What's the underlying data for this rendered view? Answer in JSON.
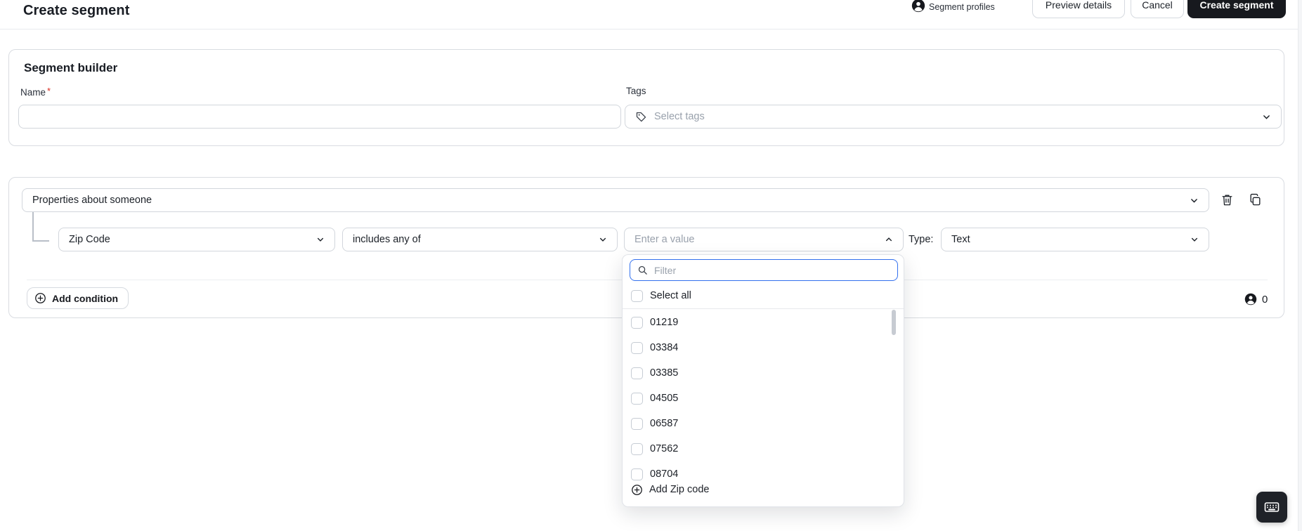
{
  "topbar": {
    "title": "Create segment",
    "profiles_label": "Segment profiles",
    "buttons": {
      "preview": "Preview details",
      "cancel": "Cancel",
      "create": "Create segment"
    }
  },
  "builder_card": {
    "title": "Segment builder",
    "name_label": "Name",
    "required_mark": "*",
    "name_value": "",
    "tags_label": "Tags",
    "tags_placeholder": "Select tags"
  },
  "filter_card": {
    "group_select_value": "Properties about someone",
    "field_select_value": "Zip Code",
    "operator_select_value": "includes any of",
    "value_placeholder": "Enter a value",
    "type_label": "Type:",
    "type_select_value": "Text",
    "add_condition_label": "Add condition",
    "contact_count": "0"
  },
  "value_dropdown": {
    "filter_placeholder": "Filter",
    "select_all_label": "Select all",
    "options": [
      "01219",
      "03384",
      "03385",
      "04505",
      "06587",
      "07562",
      "08704"
    ],
    "add_option_label": "Add Zip code"
  },
  "icons": {
    "profiles": "person-circle-icon",
    "tags": "tag-icon",
    "selects": "chevron-down-icon",
    "value_open": "chevron-up-icon",
    "row_actions": [
      "trash-icon",
      "copy-icon"
    ],
    "filter_input": "search-icon",
    "add_buttons": "plus-circle-icon",
    "floating": "keyboard-icon"
  },
  "colors": {
    "accent_blue": "#3270ee",
    "dark_button": "#17191e",
    "required_red": "#d92d20",
    "border_gray": "#d2d6dc"
  }
}
